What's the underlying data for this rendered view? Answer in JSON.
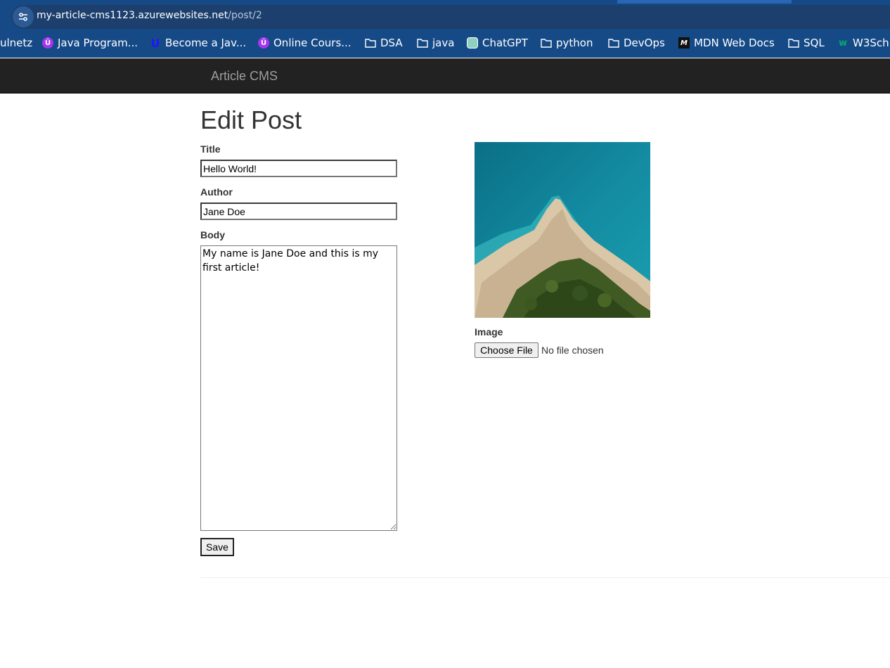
{
  "browser": {
    "url_host": "my-article-cms1123.azurewebsites.net",
    "url_path": "/post/2",
    "site_info_icon": "tune-icon",
    "bookmarks": [
      {
        "label": "ulnetz",
        "icon": "none"
      },
      {
        "label": "Java Program...",
        "icon": "udemy-icon"
      },
      {
        "label": "Become a Jav...",
        "icon": "udacity-icon"
      },
      {
        "label": "Online Cours...",
        "icon": "udemy-icon"
      },
      {
        "label": "DSA",
        "icon": "folder-icon"
      },
      {
        "label": "java",
        "icon": "folder-icon"
      },
      {
        "label": "ChatGPT",
        "icon": "chatgpt-icon"
      },
      {
        "label": "python",
        "icon": "folder-icon"
      },
      {
        "label": "DevOps",
        "icon": "folder-icon"
      },
      {
        "label": "MDN Web Docs",
        "icon": "mdn-icon"
      },
      {
        "label": "SQL",
        "icon": "folder-icon"
      },
      {
        "label": "W3Sch",
        "icon": "w3schools-icon"
      }
    ]
  },
  "navbar": {
    "brand": "Article CMS"
  },
  "page": {
    "title": "Edit Post",
    "form": {
      "title_label": "Title",
      "title_value": "Hello World!",
      "author_label": "Author",
      "author_value": "Jane Doe",
      "body_label": "Body",
      "body_value": "My name is Jane Doe and this is my first article!",
      "save_label": "Save"
    },
    "image": {
      "label": "Image",
      "choose_label": "Choose File",
      "file_status": "No file chosen"
    }
  },
  "colors": {
    "browser_chrome": "#164a86",
    "navbar_bg": "#222222",
    "brand_text": "#9d9d9d",
    "heading_text": "#333333"
  }
}
